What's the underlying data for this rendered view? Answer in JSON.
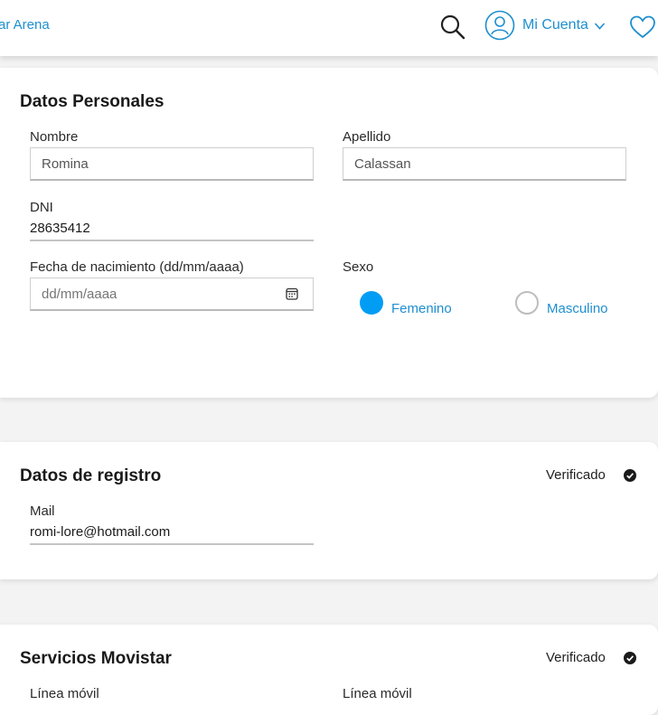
{
  "header": {
    "brand_link": "ar Arena",
    "account_label": "Mi Cuenta",
    "icons": [
      "search-icon",
      "user-avatar-icon",
      "chevron-down-icon",
      "heart-icon"
    ]
  },
  "personal": {
    "title": "Datos Personales",
    "nombre_label": "Nombre",
    "nombre_value": "Romina",
    "apellido_label": "Apellido",
    "apellido_value": "Calassan",
    "dni_label": "DNI",
    "dni_value": "28635412",
    "fecha_label": "Fecha de nacimiento (dd/mm/aaaa)",
    "fecha_placeholder": "dd/mm/aaaa",
    "sexo_label": "Sexo",
    "sexo_options": [
      "Femenino",
      "Masculino"
    ],
    "sexo_selected": "Femenino"
  },
  "registro": {
    "title": "Datos de registro",
    "status": "Verificado",
    "mail_label": "Mail",
    "mail_value": "romi-lore@hotmail.com"
  },
  "movistar": {
    "title": "Servicios Movistar",
    "status": "Verificado",
    "col1_label": "Línea móvil",
    "col2_label": "Línea móvil"
  },
  "colors": {
    "accent": "#019df4",
    "link": "#1e8fcf",
    "page_bg": "#f3f3f3"
  }
}
